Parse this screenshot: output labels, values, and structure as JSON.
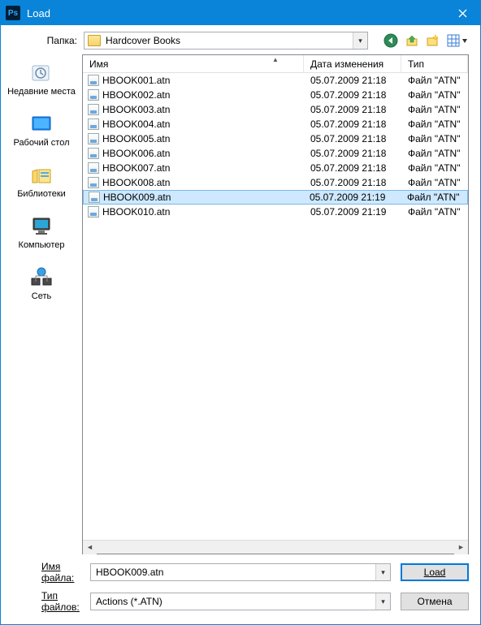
{
  "window": {
    "title": "Load"
  },
  "labels": {
    "folder": "Папка:",
    "filename": "Имя файла:",
    "filetype": "Тип файлов:",
    "load_btn": "Load",
    "cancel_btn": "Отмена"
  },
  "folder_dropdown": {
    "selected": "Hardcover Books"
  },
  "toolbar_icons": [
    "back-icon",
    "up-icon",
    "new-folder-icon",
    "view-menu-icon"
  ],
  "places": [
    {
      "id": "recent",
      "label": "Недавние места"
    },
    {
      "id": "desktop",
      "label": "Рабочий стол"
    },
    {
      "id": "libraries",
      "label": "Библиотеки"
    },
    {
      "id": "computer",
      "label": "Компьютер"
    },
    {
      "id": "network",
      "label": "Сеть"
    }
  ],
  "columns": {
    "name": "Имя",
    "date": "Дата изменения",
    "type": "Тип"
  },
  "files": [
    {
      "name": "HBOOK001.atn",
      "date": "05.07.2009 21:18",
      "type": "Файл \"ATN\""
    },
    {
      "name": "HBOOK002.atn",
      "date": "05.07.2009 21:18",
      "type": "Файл \"ATN\""
    },
    {
      "name": "HBOOK003.atn",
      "date": "05.07.2009 21:18",
      "type": "Файл \"ATN\""
    },
    {
      "name": "HBOOK004.atn",
      "date": "05.07.2009 21:18",
      "type": "Файл \"ATN\""
    },
    {
      "name": "HBOOK005.atn",
      "date": "05.07.2009 21:18",
      "type": "Файл \"ATN\""
    },
    {
      "name": "HBOOK006.atn",
      "date": "05.07.2009 21:18",
      "type": "Файл \"ATN\""
    },
    {
      "name": "HBOOK007.atn",
      "date": "05.07.2009 21:18",
      "type": "Файл \"ATN\""
    },
    {
      "name": "HBOOK008.atn",
      "date": "05.07.2009 21:18",
      "type": "Файл \"ATN\""
    },
    {
      "name": "HBOOK009.atn",
      "date": "05.07.2009 21:19",
      "type": "Файл \"ATN\""
    },
    {
      "name": "HBOOK010.atn",
      "date": "05.07.2009 21:19",
      "type": "Файл \"ATN\""
    }
  ],
  "selected_index": 8,
  "filename_value": "HBOOK009.atn",
  "filetype_value": "Actions (*.ATN)"
}
